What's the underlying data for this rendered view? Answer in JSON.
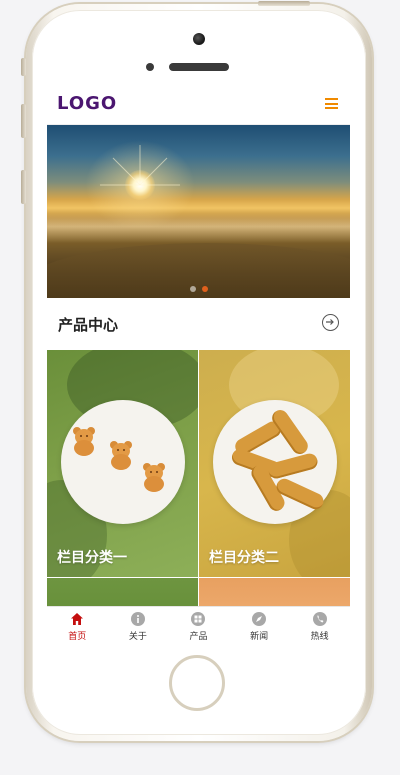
{
  "header": {
    "logo_text": "LOGO"
  },
  "section": {
    "title": "产品中心"
  },
  "products": [
    {
      "label": "栏目分类一"
    },
    {
      "label": "栏目分类二"
    }
  ],
  "bottom_nav": {
    "items": [
      {
        "label": "首页",
        "icon": "home-icon",
        "active": true
      },
      {
        "label": "关于",
        "icon": "info-icon",
        "active": false
      },
      {
        "label": "产品",
        "icon": "grid-icon",
        "active": false
      },
      {
        "label": "新闻",
        "icon": "compass-icon",
        "active": false
      },
      {
        "label": "热线",
        "icon": "phone-icon",
        "active": false
      }
    ]
  },
  "colors": {
    "logo": "#4b1670",
    "menu_icon": "#f08a00",
    "nav_active": "#c40f0f",
    "carousel_active_dot": "#e0601c"
  }
}
